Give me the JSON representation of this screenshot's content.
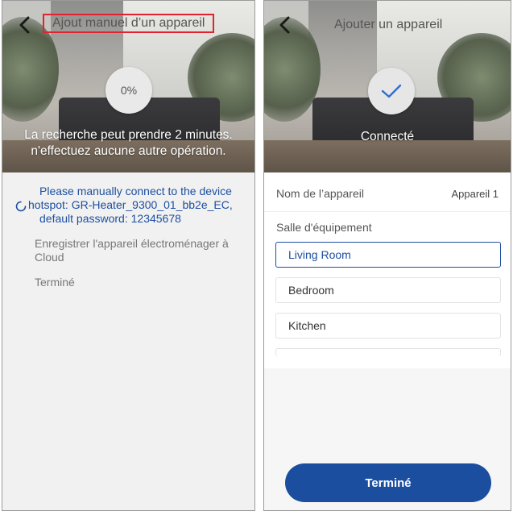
{
  "left_screen": {
    "title": "Ajout manuel d’un appareil",
    "progress": "0%",
    "hero_line1": "La recherche peut prendre 2 minutes.",
    "hero_line2": "n'effectuez aucune autre opération.",
    "steps": [
      {
        "status": "in-progress",
        "line1": "Please manually connect to the device",
        "line2": "hotspot: GR-Heater_9300_01_bb2e_EC,",
        "line3": "default password: 12345678"
      },
      {
        "status": "pending",
        "line1": "Enregistrer l'appareil électroménager à",
        "line2": "Cloud"
      },
      {
        "status": "pending",
        "line1": "Terminé"
      }
    ]
  },
  "right_screen": {
    "title": "Ajouter un appareil",
    "status_text": "Connecté",
    "device_name_label": "Nom de l’appareil",
    "device_name_value": "Appareil 1",
    "room_label": "Salle d'équipement",
    "rooms": [
      "Living Room",
      "Bedroom",
      "Kitchen"
    ],
    "selected_room": "Living Room",
    "done_button": "Terminé"
  },
  "colors": {
    "accent": "#1c4ea0",
    "highlight_box": "#e0232e"
  }
}
